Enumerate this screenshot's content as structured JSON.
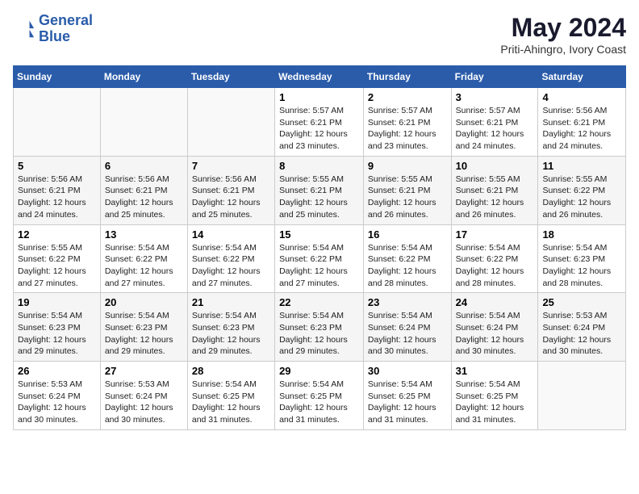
{
  "header": {
    "logo_line1": "General",
    "logo_line2": "Blue",
    "month_year": "May 2024",
    "location": "Priti-Ahingro, Ivory Coast"
  },
  "weekdays": [
    "Sunday",
    "Monday",
    "Tuesday",
    "Wednesday",
    "Thursday",
    "Friday",
    "Saturday"
  ],
  "weeks": [
    [
      {
        "day": "",
        "info": ""
      },
      {
        "day": "",
        "info": ""
      },
      {
        "day": "",
        "info": ""
      },
      {
        "day": "1",
        "info": "Sunrise: 5:57 AM\nSunset: 6:21 PM\nDaylight: 12 hours\nand 23 minutes."
      },
      {
        "day": "2",
        "info": "Sunrise: 5:57 AM\nSunset: 6:21 PM\nDaylight: 12 hours\nand 23 minutes."
      },
      {
        "day": "3",
        "info": "Sunrise: 5:57 AM\nSunset: 6:21 PM\nDaylight: 12 hours\nand 24 minutes."
      },
      {
        "day": "4",
        "info": "Sunrise: 5:56 AM\nSunset: 6:21 PM\nDaylight: 12 hours\nand 24 minutes."
      }
    ],
    [
      {
        "day": "5",
        "info": "Sunrise: 5:56 AM\nSunset: 6:21 PM\nDaylight: 12 hours\nand 24 minutes."
      },
      {
        "day": "6",
        "info": "Sunrise: 5:56 AM\nSunset: 6:21 PM\nDaylight: 12 hours\nand 25 minutes."
      },
      {
        "day": "7",
        "info": "Sunrise: 5:56 AM\nSunset: 6:21 PM\nDaylight: 12 hours\nand 25 minutes."
      },
      {
        "day": "8",
        "info": "Sunrise: 5:55 AM\nSunset: 6:21 PM\nDaylight: 12 hours\nand 25 minutes."
      },
      {
        "day": "9",
        "info": "Sunrise: 5:55 AM\nSunset: 6:21 PM\nDaylight: 12 hours\nand 26 minutes."
      },
      {
        "day": "10",
        "info": "Sunrise: 5:55 AM\nSunset: 6:21 PM\nDaylight: 12 hours\nand 26 minutes."
      },
      {
        "day": "11",
        "info": "Sunrise: 5:55 AM\nSunset: 6:22 PM\nDaylight: 12 hours\nand 26 minutes."
      }
    ],
    [
      {
        "day": "12",
        "info": "Sunrise: 5:55 AM\nSunset: 6:22 PM\nDaylight: 12 hours\nand 27 minutes."
      },
      {
        "day": "13",
        "info": "Sunrise: 5:54 AM\nSunset: 6:22 PM\nDaylight: 12 hours\nand 27 minutes."
      },
      {
        "day": "14",
        "info": "Sunrise: 5:54 AM\nSunset: 6:22 PM\nDaylight: 12 hours\nand 27 minutes."
      },
      {
        "day": "15",
        "info": "Sunrise: 5:54 AM\nSunset: 6:22 PM\nDaylight: 12 hours\nand 27 minutes."
      },
      {
        "day": "16",
        "info": "Sunrise: 5:54 AM\nSunset: 6:22 PM\nDaylight: 12 hours\nand 28 minutes."
      },
      {
        "day": "17",
        "info": "Sunrise: 5:54 AM\nSunset: 6:22 PM\nDaylight: 12 hours\nand 28 minutes."
      },
      {
        "day": "18",
        "info": "Sunrise: 5:54 AM\nSunset: 6:23 PM\nDaylight: 12 hours\nand 28 minutes."
      }
    ],
    [
      {
        "day": "19",
        "info": "Sunrise: 5:54 AM\nSunset: 6:23 PM\nDaylight: 12 hours\nand 29 minutes."
      },
      {
        "day": "20",
        "info": "Sunrise: 5:54 AM\nSunset: 6:23 PM\nDaylight: 12 hours\nand 29 minutes."
      },
      {
        "day": "21",
        "info": "Sunrise: 5:54 AM\nSunset: 6:23 PM\nDaylight: 12 hours\nand 29 minutes."
      },
      {
        "day": "22",
        "info": "Sunrise: 5:54 AM\nSunset: 6:23 PM\nDaylight: 12 hours\nand 29 minutes."
      },
      {
        "day": "23",
        "info": "Sunrise: 5:54 AM\nSunset: 6:24 PM\nDaylight: 12 hours\nand 30 minutes."
      },
      {
        "day": "24",
        "info": "Sunrise: 5:54 AM\nSunset: 6:24 PM\nDaylight: 12 hours\nand 30 minutes."
      },
      {
        "day": "25",
        "info": "Sunrise: 5:53 AM\nSunset: 6:24 PM\nDaylight: 12 hours\nand 30 minutes."
      }
    ],
    [
      {
        "day": "26",
        "info": "Sunrise: 5:53 AM\nSunset: 6:24 PM\nDaylight: 12 hours\nand 30 minutes."
      },
      {
        "day": "27",
        "info": "Sunrise: 5:53 AM\nSunset: 6:24 PM\nDaylight: 12 hours\nand 30 minutes."
      },
      {
        "day": "28",
        "info": "Sunrise: 5:54 AM\nSunset: 6:25 PM\nDaylight: 12 hours\nand 31 minutes."
      },
      {
        "day": "29",
        "info": "Sunrise: 5:54 AM\nSunset: 6:25 PM\nDaylight: 12 hours\nand 31 minutes."
      },
      {
        "day": "30",
        "info": "Sunrise: 5:54 AM\nSunset: 6:25 PM\nDaylight: 12 hours\nand 31 minutes."
      },
      {
        "day": "31",
        "info": "Sunrise: 5:54 AM\nSunset: 6:25 PM\nDaylight: 12 hours\nand 31 minutes."
      },
      {
        "day": "",
        "info": ""
      }
    ]
  ]
}
